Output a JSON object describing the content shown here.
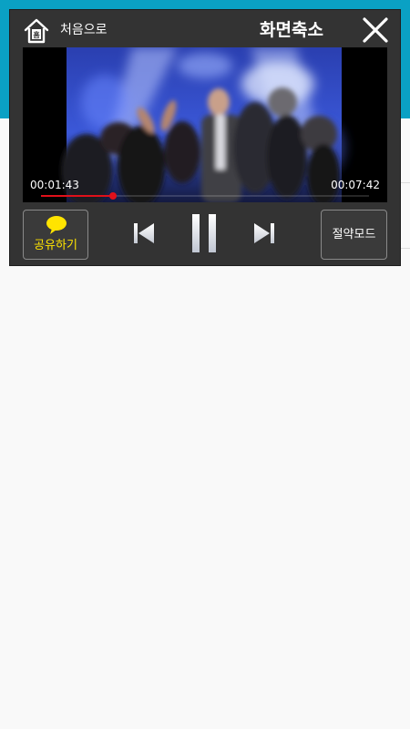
{
  "header": {
    "home_label": "처음으로",
    "title": "화면축소"
  },
  "video": {
    "current_time": "00:01:43",
    "total_time": "00:07:42",
    "progress": 0.22
  },
  "controls": {
    "share_label": "공유하기",
    "saving_mode_label": "절약모드"
  },
  "icons": {
    "home": "home-icon",
    "close": "close-icon",
    "share": "speech-bubble-icon",
    "previous": "skip-previous-icon",
    "pause": "pause-icon",
    "next": "skip-next-icon"
  },
  "colors": {
    "app_bar": "#0aa1c4",
    "player_bg": "#333333",
    "progress": "#e0101a",
    "share_accent": "#ffe400"
  }
}
